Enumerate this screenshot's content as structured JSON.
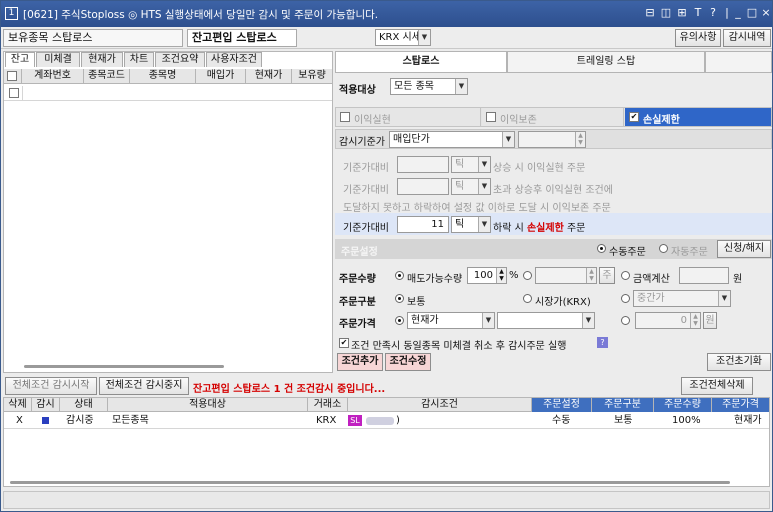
{
  "window": {
    "icon": "1",
    "title": "[0621] 주식Stoploss   ◎ HTS 실행상태에서 당일만 감시 및 주문이 가능합니다.",
    "controls": [
      "⊟",
      "◫",
      "⊞",
      "T",
      "?",
      "|",
      "_",
      "□",
      "×"
    ]
  },
  "toolbar": {
    "left_label": "보유종목 스탑로스",
    "center_label": "잔고편입 스탑로스",
    "market_select": "KRX 시세",
    "notice_button": "유의사항",
    "monitor_button": "감시내역"
  },
  "left": {
    "tabs": [
      "잔고",
      "미체결",
      "현재가",
      "차트",
      "조건요약",
      "사용자조건"
    ],
    "columns": [
      "계좌번호",
      "종목코드",
      "종목명",
      "매입가",
      "현재가",
      "보유량"
    ]
  },
  "right": {
    "tabs": [
      "스탑로스",
      "트레일링 스탑",
      ""
    ],
    "target_label": "적용대상",
    "target_value": "모든 종목",
    "sec_profit": "이익실현",
    "sec_preserve": "이익보존",
    "sec_stoploss": "손실제한",
    "check_mark": "✔",
    "base_price_label": "감시기준가",
    "base_price_value": "매입단가",
    "row1": {
      "label": "기준가대비",
      "unit": "틱",
      "text": "상승 시   이익실현   주문"
    },
    "row2": {
      "label": "기준가대비",
      "unit": "틱",
      "text": "초과 상승후 이익실현 조건에"
    },
    "row3": {
      "text": "도달하지 못하고 하락하여 설정 값 이하로 도달 시  이익보존 주문"
    },
    "row4": {
      "label": "기준가대비",
      "value": "11",
      "unit": "틱",
      "text_pre": "하락 시",
      "text_bold": "손실제한",
      "text_post": "주문"
    },
    "order_settings_label": "주문설정",
    "order_mode_auto_man": "수동주문",
    "order_mode_auto": "자동주문",
    "order_mode_btn": "신청/해지",
    "qty_label": "주문수량",
    "qty_sellable": "매도가능수량",
    "qty_value": "100",
    "qty_unit": "%",
    "qty_calc": "금액계산",
    "qty_won": "원",
    "qty_arrow": "주",
    "type_label": "주문구분",
    "type_normal": "보통",
    "type_market": "시장가(KRX)",
    "type_mid": "중간가",
    "price_label": "주문가격",
    "price_value": "현재가",
    "price_zero": "0",
    "price_won": "원",
    "cancel_check_text": "조건 만족시 동일종목 미체결 취소 후 감시주문 실행",
    "help": "?",
    "add_button": "조건추가",
    "edit_button": "조건수정",
    "reset_button": "조건초기화"
  },
  "mid": {
    "start_button": "전체조건 감시시작",
    "stop_button": "전체조건 감시중지",
    "status_text": "잔고편입 스탑로스 1 건 조건감시 중입니다...",
    "delete_all_button": "조건전체삭제"
  },
  "bottom": {
    "columns": [
      "삭제",
      "감시",
      "상태",
      "적용대상",
      "거래소",
      "감시조건",
      "주문설정",
      "주문구분",
      "주문수량",
      "주문가격"
    ],
    "row": {
      "del": "X",
      "status": "감시중",
      "target": "모든종목",
      "exchange": "KRX",
      "sl": "SL",
      "cond_tail": ")",
      "setting": "수동",
      "type": "보통",
      "qty": "100%",
      "price": "현재가"
    }
  },
  "colors": {
    "title_bg": "#2d4f8e",
    "active_tab": "#ffffff",
    "highlight_row": "#dde6f7",
    "stoploss_blue": "#2f66c8",
    "red_text": "#d40000",
    "button_pink": "#f7d6d6"
  }
}
